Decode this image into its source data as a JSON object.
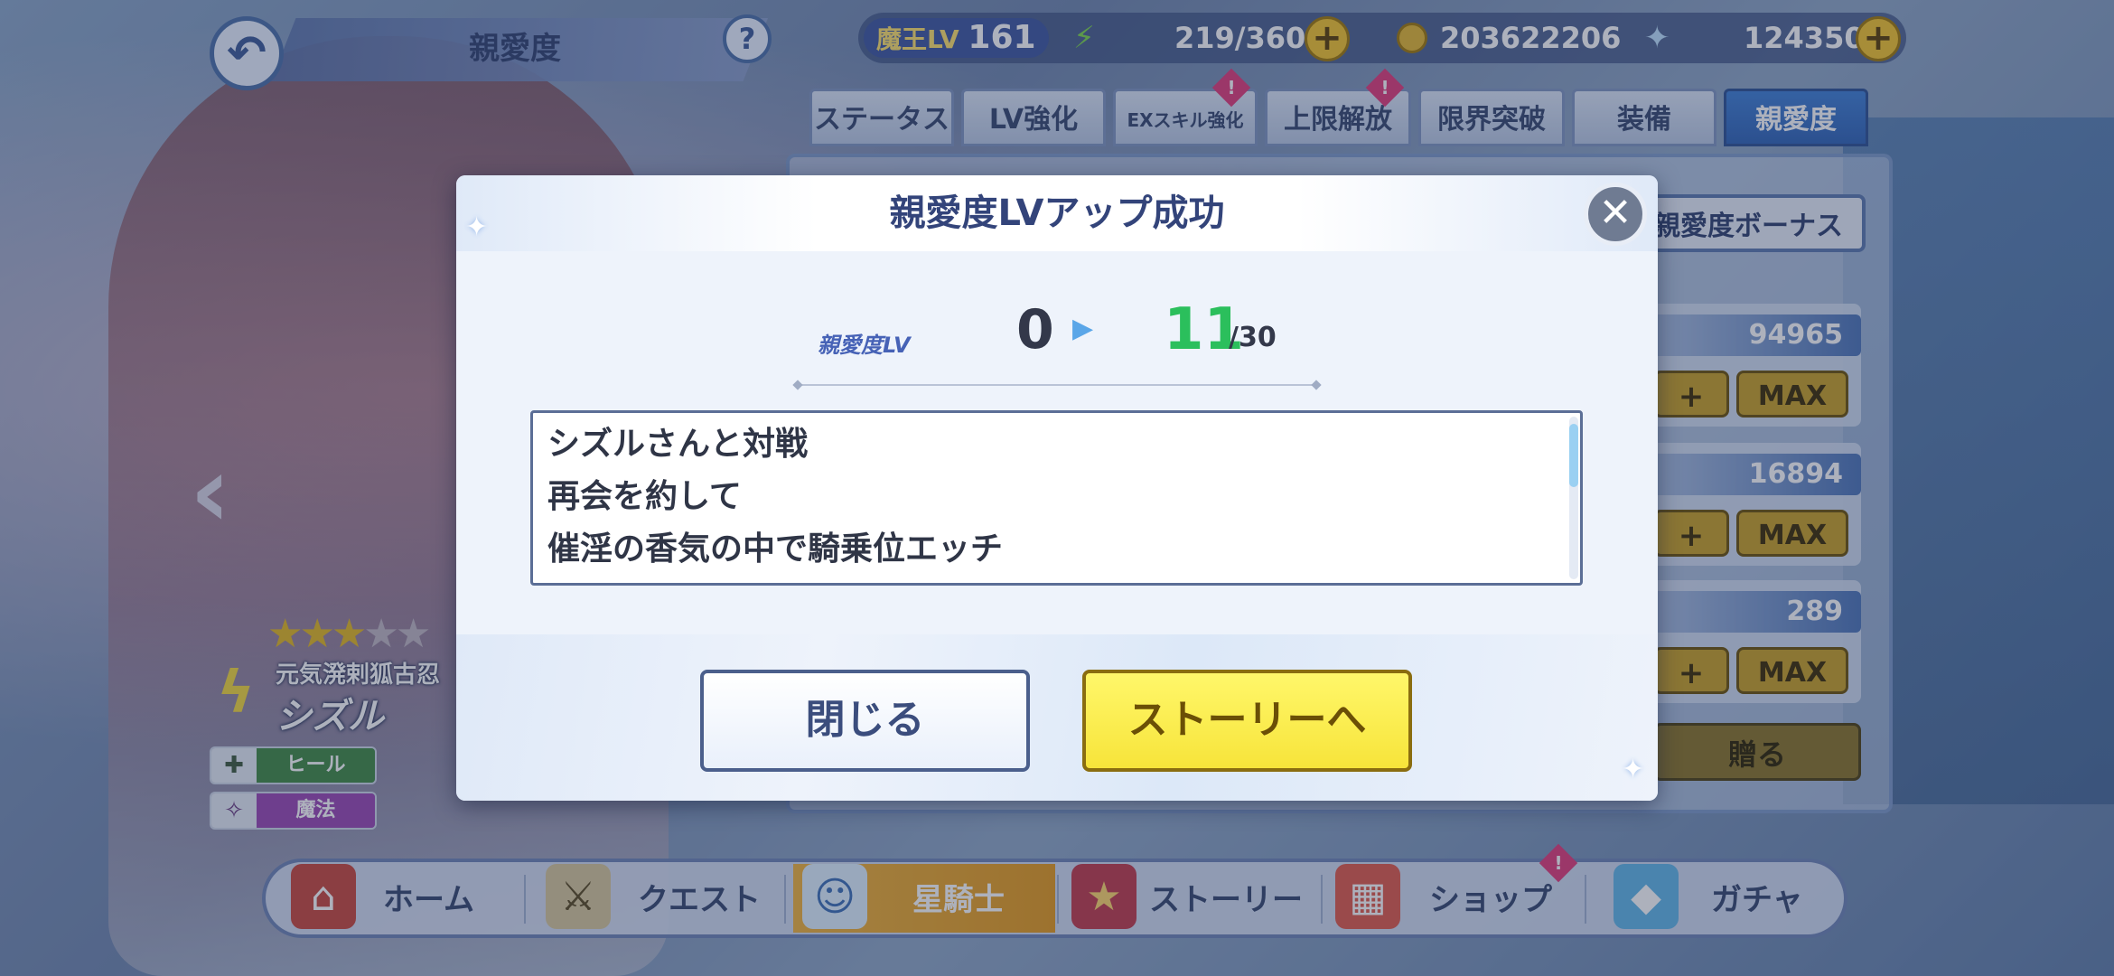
{
  "header": {
    "title": "親愛度",
    "help_label": "?",
    "player_level_label": "魔王LV",
    "player_level": "161",
    "stamina": "219/360",
    "gold": "203622206",
    "gems": "124350",
    "plus_label": "+"
  },
  "tabs": [
    {
      "label": "ステータス"
    },
    {
      "label": "LV強化"
    },
    {
      "label": "EXスキル強化",
      "badge": "!"
    },
    {
      "label": "上限解放",
      "badge": "!"
    },
    {
      "label": "限界突破"
    },
    {
      "label": "装備"
    },
    {
      "label": "親愛度",
      "active": true
    }
  ],
  "panel": {
    "bonus_button": "親愛度ボーナス",
    "stats": [
      {
        "value": "94965",
        "plus": "+",
        "max": "MAX"
      },
      {
        "value": "16894",
        "plus": "+",
        "max": "MAX"
      },
      {
        "value": "289",
        "plus": "+",
        "max": "MAX"
      }
    ],
    "gift_button": "贈る"
  },
  "character": {
    "stars": "★★★★★",
    "rarity_filled": 3,
    "subtitle": "元気溌剌狐古忍",
    "name": "シズル",
    "roles": [
      {
        "icon": "heal-icon",
        "label": "ヒール",
        "color": "#3f8a43"
      },
      {
        "icon": "magic-icon",
        "label": "魔法",
        "color": "#9a46b4"
      }
    ]
  },
  "dialog": {
    "title": "親愛度LVアップ成功",
    "close_label": "✕",
    "level_caption": "親愛度LV",
    "level_from": "0",
    "level_to": "11",
    "level_max": "/30",
    "story_lines": [
      "シズルさんと対戦",
      "再会を約して",
      "催淫の香気の中で騎乗位エッチ"
    ],
    "close_button": "閉じる",
    "story_button": "ストーリーへ"
  },
  "nav": {
    "items": [
      {
        "label": "ホーム",
        "icon": "home-icon"
      },
      {
        "label": "クエスト",
        "icon": "sword-icon"
      },
      {
        "label": "星騎士",
        "icon": "knight-icon",
        "active": true
      },
      {
        "label": "ストーリー",
        "icon": "book-icon"
      },
      {
        "label": "ショップ",
        "icon": "shop-icon",
        "badge": "!"
      },
      {
        "label": "ガチャ",
        "icon": "gacha-icon"
      }
    ]
  }
}
